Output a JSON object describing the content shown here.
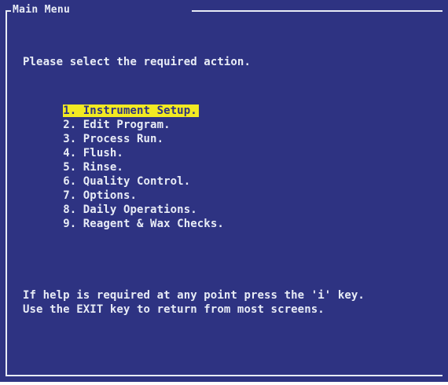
{
  "screen": {
    "title": "Main Menu",
    "prompt": "Please select the required action.",
    "menu": [
      {
        "label": "1. Instrument Setup.",
        "selected": true
      },
      {
        "label": "2. Edit Program.",
        "selected": false
      },
      {
        "label": "3. Process Run.",
        "selected": false
      },
      {
        "label": "4. Flush.",
        "selected": false
      },
      {
        "label": "5. Rinse.",
        "selected": false
      },
      {
        "label": "6. Quality Control.",
        "selected": false
      },
      {
        "label": "7. Options.",
        "selected": false
      },
      {
        "label": "8. Daily Operations.",
        "selected": false
      },
      {
        "label": "9. Reagent & Wax Checks.",
        "selected": false
      }
    ],
    "help_line_1": "If help is required at any point press the 'i' key.",
    "help_line_2": "Use the EXIT key to return from most screens."
  },
  "colors": {
    "background": "#2e3382",
    "text": "#e8ecf6",
    "highlight_background": "#f2ea22",
    "highlight_text": "#2e3382"
  }
}
